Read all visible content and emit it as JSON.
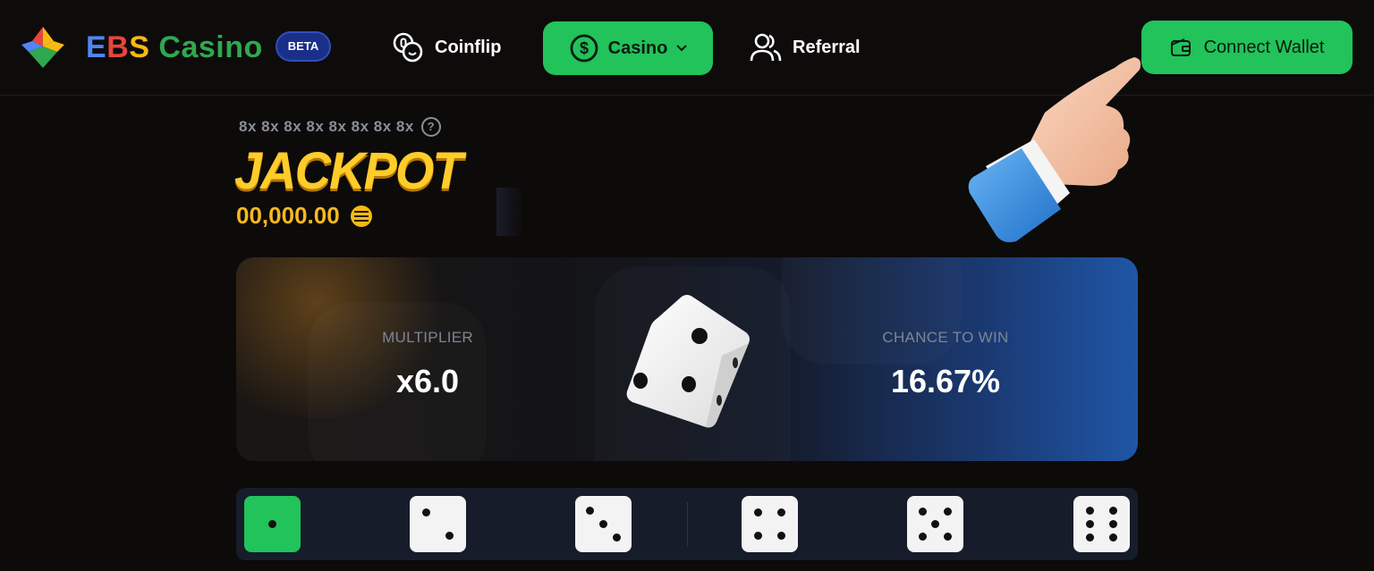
{
  "header": {
    "brand": {
      "e": "E",
      "b": "B",
      "s": "S",
      "rest": "Casino",
      "badge": "BETA"
    },
    "nav": {
      "coinflip": "Coinflip",
      "casino": "Casino",
      "referral": "Referral"
    },
    "connect_wallet": "Connect Wallet"
  },
  "jackpot": {
    "multipliers": "8x 8x 8x 8x 8x 8x 8x 8x",
    "title": "JACKPOT",
    "amount": "00,000.00"
  },
  "game": {
    "multiplier_label": "MULTIPLIER",
    "multiplier_value": "x6.0",
    "chance_label": "CHANCE TO WIN",
    "chance_value": "16.67%"
  },
  "dice_selector": {
    "faces": [
      1,
      2,
      3,
      4,
      5,
      6
    ],
    "selected": 1
  },
  "colors": {
    "accent": "#21c35a",
    "jackpot": "#ffcc2a",
    "panel_blue": "#1f56a6",
    "background": "#0d0a0a"
  }
}
